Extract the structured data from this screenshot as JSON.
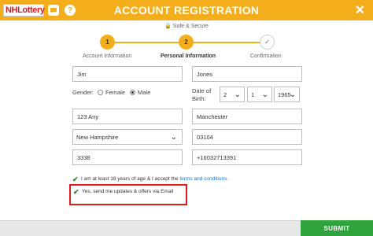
{
  "header": {
    "logo_text": "NHLottery",
    "title": "ACCOUNT REGISTRATION",
    "help_glyph": "?",
    "close_glyph": "✕",
    "brand_color": "#f5ae1b"
  },
  "safe_secure": "🔒 Safe & Secure",
  "stepper": {
    "steps": [
      {
        "number": "1",
        "label": "Account Information",
        "state": "complete"
      },
      {
        "number": "2",
        "label": "Personal Information",
        "state": "active"
      },
      {
        "number": "✓",
        "label": "Confirmation",
        "state": "pending"
      }
    ]
  },
  "form": {
    "first_name": "Jim",
    "last_name": "Jones",
    "gender_label": "Gender:",
    "gender_options": [
      "Female",
      "Male"
    ],
    "gender_selected": "Male",
    "dob_label_line1": "Date of",
    "dob_label_line2": "Birth:",
    "dob_month": "2",
    "dob_day": "1",
    "dob_year": "1965",
    "address": "123 Any",
    "city": "Manchester",
    "state": "New Hampshire",
    "zip": "03104",
    "pin": "3338",
    "phone": "+16032713391"
  },
  "checkboxes": {
    "age_text": "I am at least 18 years of age & I accept the ",
    "age_link": "terms and conditions",
    "age_suffix": ".",
    "email_text": "Yes, send me updates & offers via Email"
  },
  "footer": {
    "submit_label": "SUBMIT"
  }
}
